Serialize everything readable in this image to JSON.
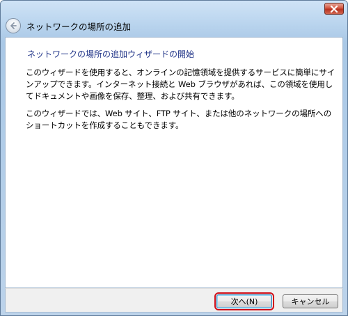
{
  "window": {
    "title": "ネットワークの場所の追加"
  },
  "icons": {
    "back": "back-arrow-icon",
    "close": "close-x-icon"
  },
  "content": {
    "main_instruction": "ネットワークの場所の追加ウィザードの開始",
    "paragraph1": "このウィザードを使用すると、オンラインの記憶領域を提供するサービスに簡単にサインアップできます。インターネット接続と Web ブラウザがあれば、この領域を使用してドキュメントや画像を保存、整理、および共有できます。",
    "paragraph2": "このウィザードでは、Web サイト、FTP サイト、または他のネットワークの場所へのショートカットを作成することもできます。"
  },
  "buttons": {
    "next": "次へ(N)",
    "cancel": "キャンセル"
  },
  "colors": {
    "instruction_text": "#1e3287",
    "highlight_outline": "#d0101a",
    "close_button": "#c8412c"
  }
}
